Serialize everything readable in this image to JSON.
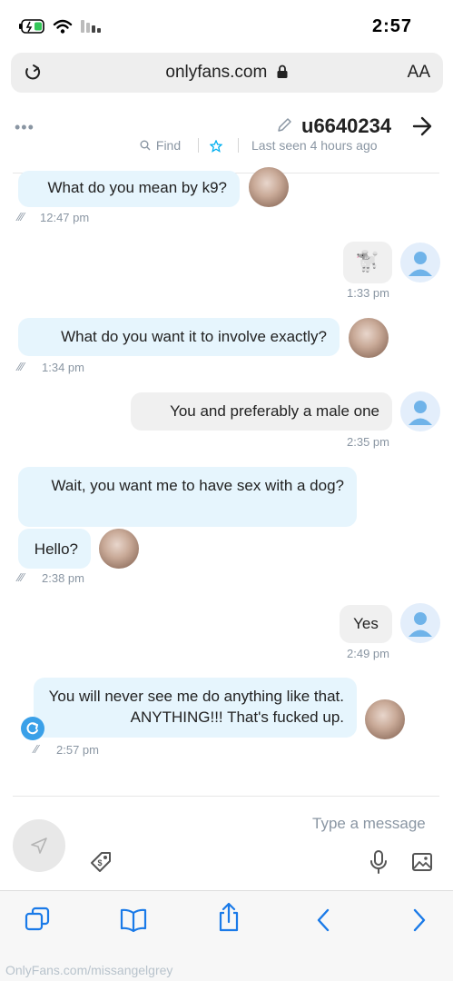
{
  "status_bar": {
    "time": "2:57"
  },
  "browser": {
    "url": "onlyfans.com",
    "text_size_label": "AA"
  },
  "chat_header": {
    "username": "u6640234",
    "last_seen": "Last seen 4 hours ago",
    "find_label": "Find"
  },
  "messages": [
    {
      "side": "model",
      "text": "What do you mean by k9?",
      "time": "12:47 pm"
    },
    {
      "side": "user",
      "text": "🐩",
      "time": "1:33 pm"
    },
    {
      "side": "model",
      "text": "What do you want it to involve exactly?",
      "time": "1:34 pm"
    },
    {
      "side": "user",
      "text": "You and preferably a male one",
      "time": "2:35 pm"
    },
    {
      "side": "model",
      "text": "Wait, you want me to have sex with a dog?",
      "time": ""
    },
    {
      "side": "model",
      "text": "Hello?",
      "time": "2:38 pm"
    },
    {
      "side": "user",
      "text": "Yes",
      "time": "2:49 pm"
    },
    {
      "side": "model",
      "text": "You will never see me do anything like that. ANYTHING!!! That's fucked up.",
      "time": "2:57 pm"
    }
  ],
  "composer": {
    "placeholder": "Type a message"
  },
  "watermark": "OnlyFans.com/missangelgrey",
  "colors": {
    "accent": "#00aff0",
    "incoming_bubble": "#e6f5fd",
    "outgoing_bubble": "#f0f0f0",
    "muted": "#8a96a3"
  },
  "icons": [
    "signal-icon",
    "wifi-icon",
    "battery-icon",
    "reload-icon",
    "lock-icon",
    "back-arrow-icon",
    "pencil-icon",
    "star-icon",
    "search-icon",
    "more-dots-icon",
    "send-icon",
    "price-tag-icon",
    "microphone-icon",
    "image-icon",
    "tabs-icon",
    "bookmarks-icon",
    "share-icon",
    "nav-back-icon",
    "nav-forward-icon"
  ]
}
